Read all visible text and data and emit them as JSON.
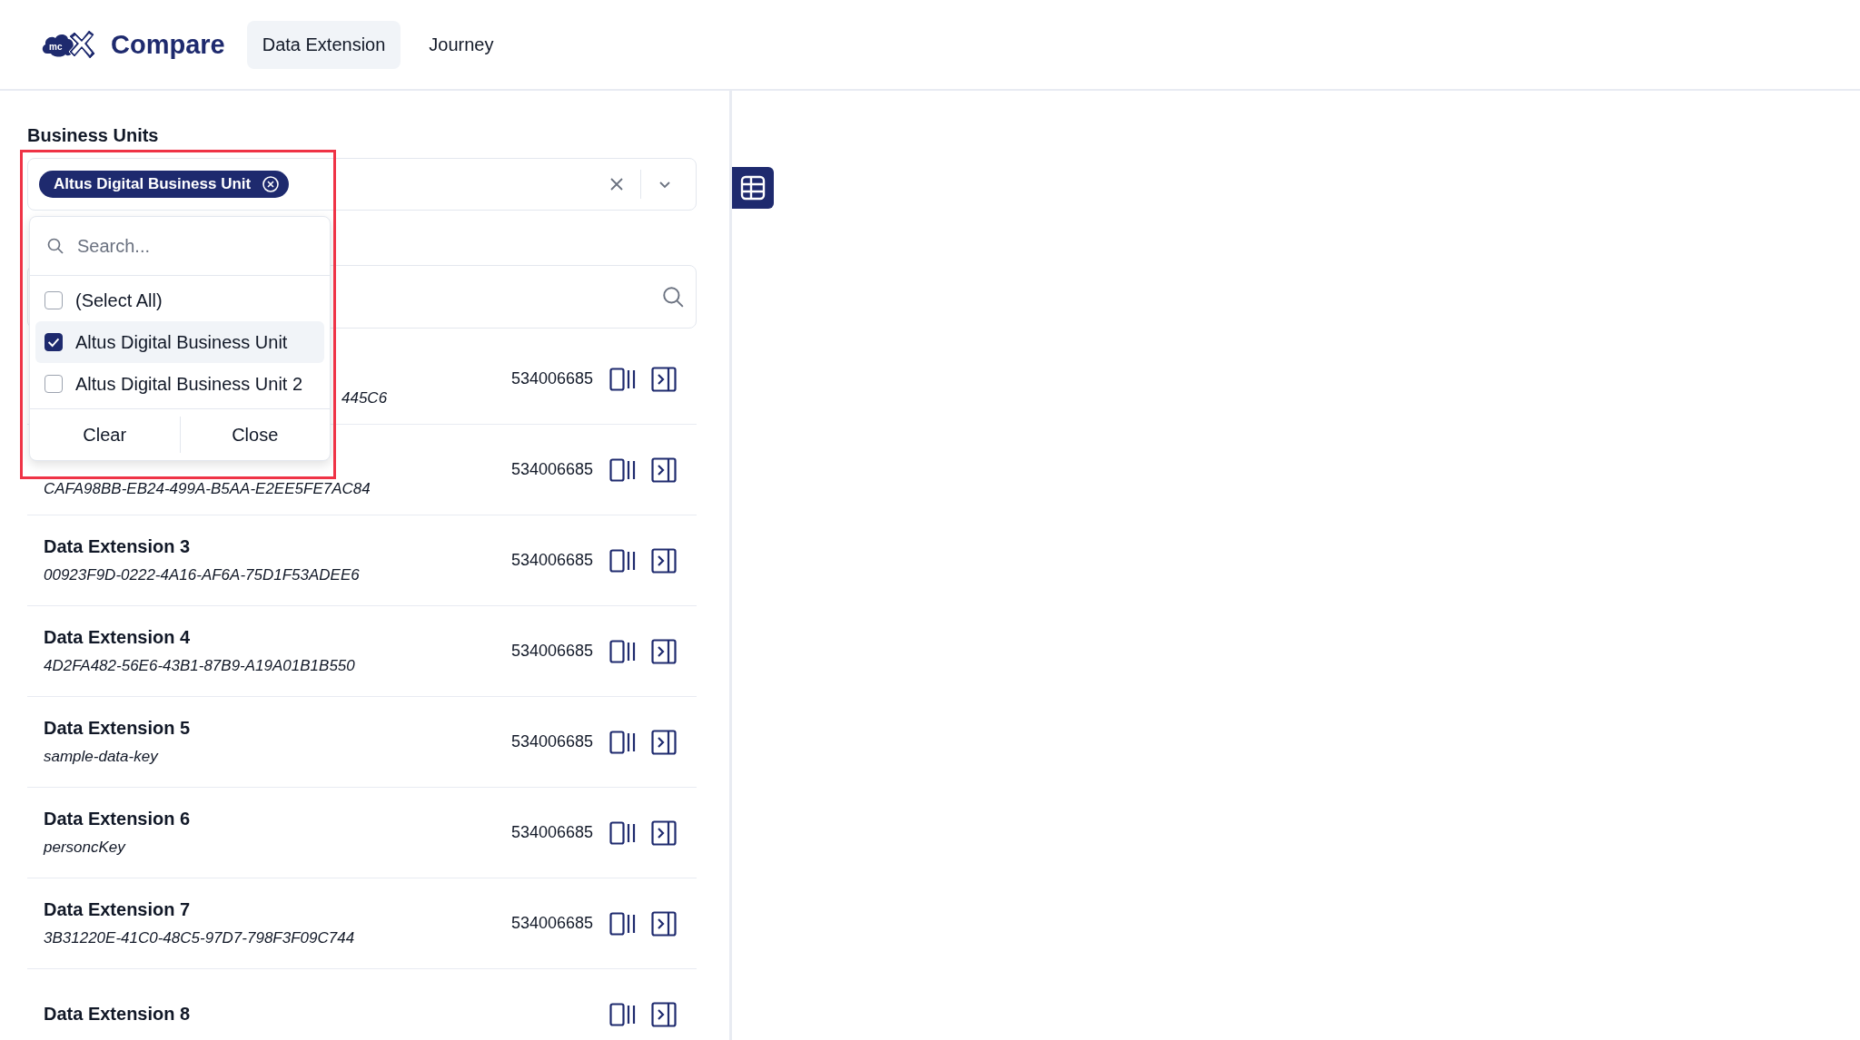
{
  "app": {
    "logo_text": "mc",
    "title": "Compare"
  },
  "tabs": [
    {
      "label": "Data Extension",
      "selected": true
    },
    {
      "label": "Journey",
      "selected": false
    }
  ],
  "business_units": {
    "label": "Business Units",
    "chips": [
      {
        "label": "Altus Digital Business Unit"
      }
    ],
    "dropdown": {
      "search_placeholder": "Search...",
      "options": [
        {
          "label": "(Select All)",
          "checked": false,
          "selected": false
        },
        {
          "label": "Altus Digital Business Unit",
          "checked": true,
          "selected": true
        },
        {
          "label": "Altus Digital Business Unit 2",
          "checked": false,
          "selected": false
        }
      ],
      "buttons": [
        "Clear",
        "Close"
      ]
    }
  },
  "data_extensions": [
    {
      "key": "445C6",
      "kind": "partial",
      "number": "534006685"
    },
    {
      "key": "CAFA98BB-EB24-499A-B5AA-E2EE5FE7AC84",
      "kind": "full",
      "number": "534006685"
    },
    {
      "name": "Data Extension 3",
      "key": "00923F9D-0222-4A16-AF6A-75D1F53ADEE6",
      "number": "534006685"
    },
    {
      "name": "Data Extension 4",
      "key": "4D2FA482-56E6-43B1-87B9-A19A01B1B550",
      "number": "534006685"
    },
    {
      "name": "Data Extension 5",
      "key": "sample-data-key",
      "number": "534006685"
    },
    {
      "name": "Data Extension 6",
      "key": "personcKey",
      "number": "534006685"
    },
    {
      "name": "Data Extension 7",
      "key": "3B31220E-41C0-48C5-97D7-798F3F09C744",
      "number": "534006685"
    },
    {
      "name": "Data Extension 8"
    }
  ]
}
